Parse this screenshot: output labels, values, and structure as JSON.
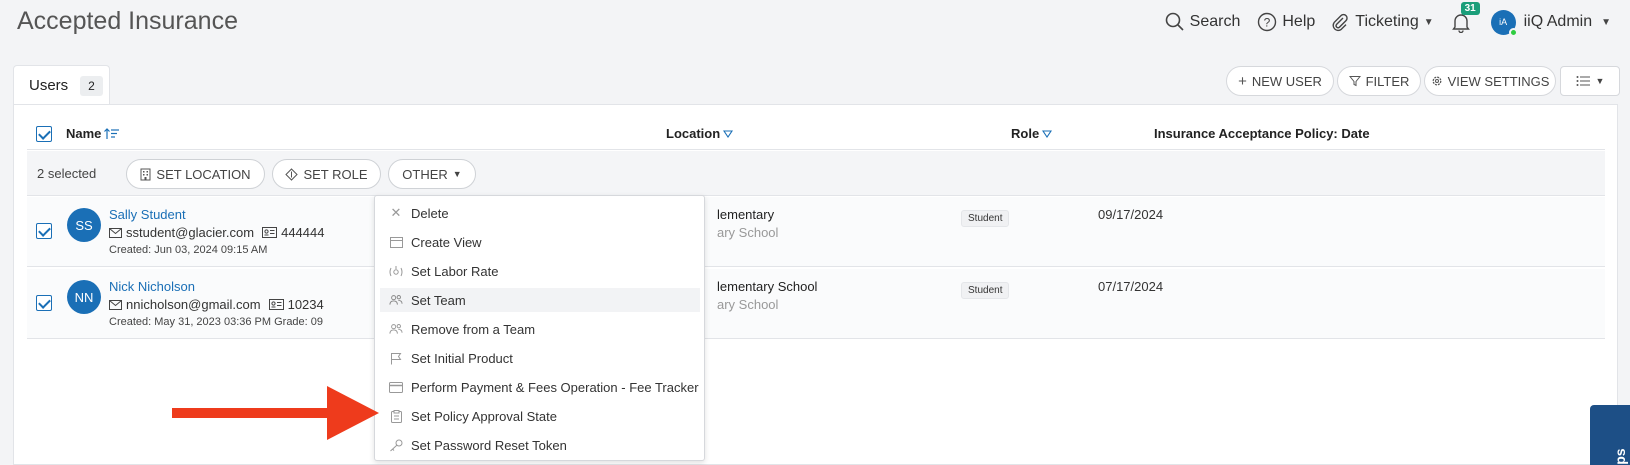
{
  "header": {
    "title": "Accepted Insurance",
    "search_label": "Search",
    "help_label": "Help",
    "ticketing_label": "Ticketing",
    "notification_count": "31",
    "user_initials": "iA",
    "user_name": "iiQ Admin"
  },
  "tab": {
    "label": "Users",
    "count": "2"
  },
  "toolbar": {
    "new_user": "NEW USER",
    "filter": "FILTER",
    "view_settings": "VIEW SETTINGS"
  },
  "table": {
    "columns": {
      "name": "Name",
      "location": "Location",
      "role": "Role",
      "date": "Insurance Acceptance Policy: Date"
    },
    "selection": {
      "selected_text": "2 selected",
      "set_location": "SET LOCATION",
      "set_role": "SET ROLE",
      "other": "OTHER"
    },
    "rows": [
      {
        "initials": "SS",
        "name": "Sally Student",
        "email": "sstudent@glacier.com",
        "id": "444444",
        "created": "Created: Jun 03, 2024 09:15 AM",
        "location_1": "lementary",
        "location_2": "ary School",
        "role": "Student",
        "date": "09/17/2024"
      },
      {
        "initials": "NN",
        "name": "Nick Nicholson",
        "email": "nnicholson@gmail.com",
        "id": "10234",
        "created": "Created: May 31, 2023 03:36 PM Grade: 09",
        "location_1": "lementary School",
        "location_2": "ary School",
        "role": "Student",
        "date": "07/17/2024"
      }
    ]
  },
  "other_menu": {
    "items": [
      {
        "label": "Delete",
        "icon": "close-icon"
      },
      {
        "label": "Create View",
        "icon": "view-icon"
      },
      {
        "label": "Set Labor Rate",
        "icon": "labor-rate-icon"
      },
      {
        "label": "Set Team",
        "icon": "team-icon"
      },
      {
        "label": "Remove from a Team",
        "icon": "team-remove-icon"
      },
      {
        "label": "Set Initial Product",
        "icon": "flag-icon"
      },
      {
        "label": "Perform Payment & Fees Operation - Fee Tracker",
        "icon": "credit-card-icon"
      },
      {
        "label": "Set Policy Approval State",
        "icon": "clipboard-icon"
      },
      {
        "label": "Set Password Reset Token",
        "icon": "key-icon"
      }
    ]
  },
  "tips_label": "Tips",
  "colors": {
    "accent": "#1a6fb6",
    "arrow": "#ee3b1c",
    "badge": "#1a9e7a",
    "tips_tab": "#1d4f86"
  }
}
